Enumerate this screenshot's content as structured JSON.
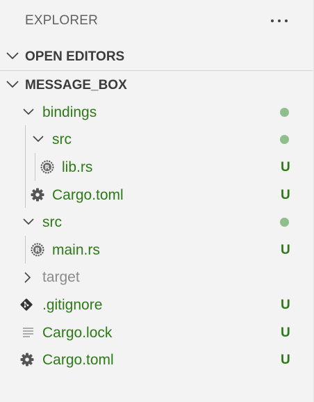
{
  "explorer": {
    "title": "EXPLORER",
    "more_actions": "···"
  },
  "sections": {
    "open_editors": "OPEN EDITORS",
    "project": "MESSAGE_BOX"
  },
  "tree": [
    {
      "name": "bindings",
      "kind": "folder",
      "expanded": true,
      "status": "dot"
    },
    {
      "name": "src",
      "kind": "folder",
      "expanded": true,
      "status": "dot"
    },
    {
      "name": "lib.rs",
      "kind": "rust-file",
      "status": "U"
    },
    {
      "name": "Cargo.toml",
      "kind": "settings-file",
      "status": "U"
    },
    {
      "name": "src",
      "kind": "folder",
      "expanded": true,
      "status": "dot"
    },
    {
      "name": "main.rs",
      "kind": "rust-file",
      "status": "U"
    },
    {
      "name": "target",
      "kind": "folder",
      "expanded": false,
      "status": ""
    },
    {
      "name": ".gitignore",
      "kind": "git-file",
      "status": "U"
    },
    {
      "name": "Cargo.lock",
      "kind": "lines-file",
      "status": "U"
    },
    {
      "name": "Cargo.toml",
      "kind": "settings-file",
      "status": "U"
    }
  ],
  "colors": {
    "untracked_text": "#2c7a17",
    "modified_dot": "#8fbf8a",
    "ignored_text": "#8a8a8a",
    "background": "#f3f3f3"
  }
}
